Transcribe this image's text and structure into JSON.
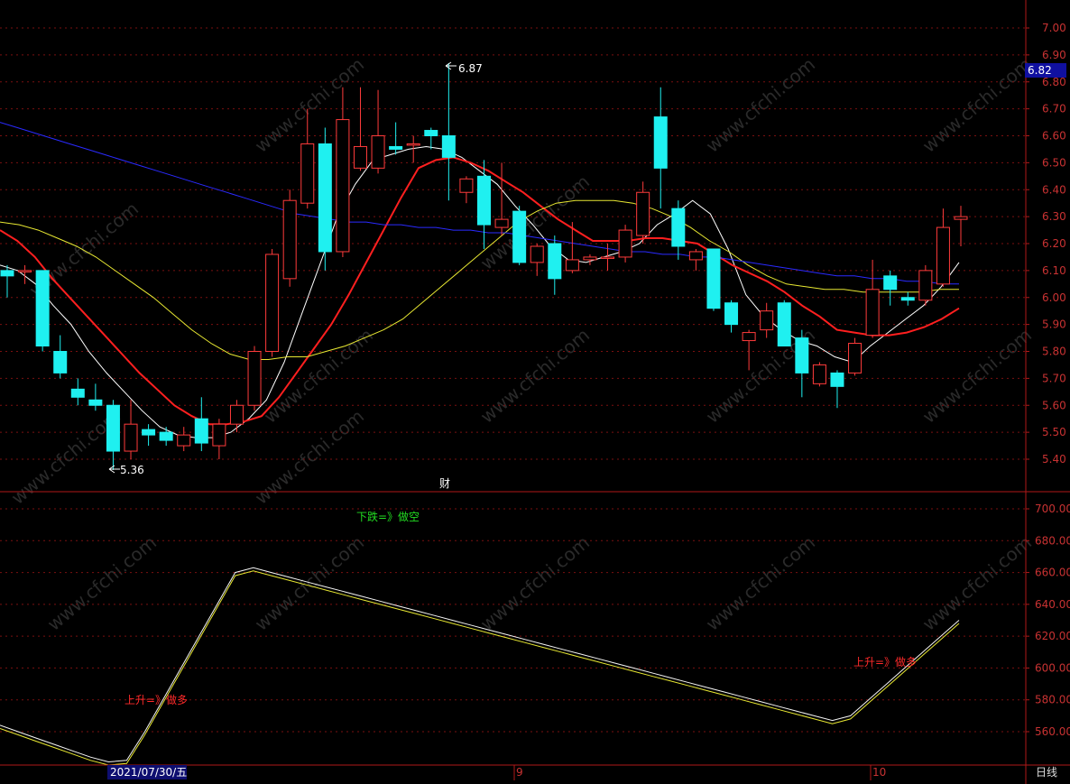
{
  "colors": {
    "up": "#ff3b3b",
    "down": "#1ff0f0",
    "ma5": "#ffffff",
    "ma10": "#ff1f1f",
    "ma20": "#e8e832",
    "ma60": "#2a2aff",
    "grid": "#7a1010",
    "axis_text": "#c83232",
    "price_badge_bg": "#1010a0",
    "price_badge_text": "#ffffff"
  },
  "watermark": "www.cfchi.com",
  "chart_data": [
    {
      "type": "candlestick",
      "yaxis": {
        "ylim": [
          5.33,
          7.07
        ],
        "ticks": [
          "5.40",
          "5.50",
          "5.60",
          "5.70",
          "5.80",
          "5.90",
          "6.00",
          "6.10",
          "6.20",
          "6.30",
          "6.40",
          "6.50",
          "6.60",
          "6.70",
          "6.80",
          "6.90",
          "7.00"
        ]
      },
      "current_price": "6.82",
      "annotations": {
        "high_label": "6.87",
        "low_label": "5.36",
        "marker": "财"
      },
      "candles": [
        {
          "o": 6.1,
          "h": 6.12,
          "l": 6.0,
          "c": 6.08
        },
        {
          "o": 6.1,
          "h": 6.12,
          "l": 6.05,
          "c": 6.1
        },
        {
          "o": 6.1,
          "h": 6.1,
          "l": 5.8,
          "c": 5.82
        },
        {
          "o": 5.8,
          "h": 5.86,
          "l": 5.7,
          "c": 5.72
        },
        {
          "o": 5.66,
          "h": 5.7,
          "l": 5.6,
          "c": 5.63
        },
        {
          "o": 5.62,
          "h": 5.68,
          "l": 5.58,
          "c": 5.6
        },
        {
          "o": 5.6,
          "h": 5.62,
          "l": 5.36,
          "c": 5.43
        },
        {
          "o": 5.43,
          "h": 5.62,
          "l": 5.4,
          "c": 5.53
        },
        {
          "o": 5.51,
          "h": 5.53,
          "l": 5.45,
          "c": 5.49
        },
        {
          "o": 5.5,
          "h": 5.52,
          "l": 5.45,
          "c": 5.47
        },
        {
          "o": 5.45,
          "h": 5.52,
          "l": 5.43,
          "c": 5.49
        },
        {
          "o": 5.55,
          "h": 5.63,
          "l": 5.43,
          "c": 5.46
        },
        {
          "o": 5.45,
          "h": 5.55,
          "l": 5.4,
          "c": 5.53
        },
        {
          "o": 5.53,
          "h": 5.62,
          "l": 5.5,
          "c": 5.6
        },
        {
          "o": 5.6,
          "h": 5.82,
          "l": 5.58,
          "c": 5.8
        },
        {
          "o": 5.8,
          "h": 6.18,
          "l": 5.78,
          "c": 6.16
        },
        {
          "o": 6.07,
          "h": 6.4,
          "l": 6.04,
          "c": 6.36
        },
        {
          "o": 6.35,
          "h": 6.7,
          "l": 6.33,
          "c": 6.57
        },
        {
          "o": 6.57,
          "h": 6.63,
          "l": 6.1,
          "c": 6.17
        },
        {
          "o": 6.17,
          "h": 6.78,
          "l": 6.15,
          "c": 6.66
        },
        {
          "o": 6.48,
          "h": 6.78,
          "l": 6.47,
          "c": 6.56
        },
        {
          "o": 6.48,
          "h": 6.77,
          "l": 6.46,
          "c": 6.6
        },
        {
          "o": 6.56,
          "h": 6.65,
          "l": 6.53,
          "c": 6.55
        },
        {
          "o": 6.57,
          "h": 6.6,
          "l": 6.5,
          "c": 6.57
        },
        {
          "o": 6.62,
          "h": 6.63,
          "l": 6.55,
          "c": 6.6
        },
        {
          "o": 6.6,
          "h": 6.87,
          "l": 6.36,
          "c": 6.52
        },
        {
          "o": 6.39,
          "h": 6.45,
          "l": 6.35,
          "c": 6.44
        },
        {
          "o": 6.45,
          "h": 6.51,
          "l": 6.18,
          "c": 6.27
        },
        {
          "o": 6.26,
          "h": 6.5,
          "l": 6.23,
          "c": 6.29
        },
        {
          "o": 6.32,
          "h": 6.34,
          "l": 6.12,
          "c": 6.13
        },
        {
          "o": 6.13,
          "h": 6.2,
          "l": 6.08,
          "c": 6.19
        },
        {
          "o": 6.2,
          "h": 6.23,
          "l": 6.01,
          "c": 6.07
        },
        {
          "o": 6.1,
          "h": 6.28,
          "l": 6.09,
          "c": 6.14
        },
        {
          "o": 6.14,
          "h": 6.16,
          "l": 6.12,
          "c": 6.15
        },
        {
          "o": 6.15,
          "h": 6.2,
          "l": 6.1,
          "c": 6.15
        },
        {
          "o": 6.15,
          "h": 6.27,
          "l": 6.13,
          "c": 6.25
        },
        {
          "o": 6.23,
          "h": 6.43,
          "l": 6.2,
          "c": 6.39
        },
        {
          "o": 6.67,
          "h": 6.78,
          "l": 6.33,
          "c": 6.48
        },
        {
          "o": 6.33,
          "h": 6.36,
          "l": 6.14,
          "c": 6.19
        },
        {
          "o": 6.14,
          "h": 6.18,
          "l": 6.1,
          "c": 6.17
        },
        {
          "o": 6.18,
          "h": 6.18,
          "l": 5.95,
          "c": 5.96
        },
        {
          "o": 5.98,
          "h": 5.99,
          "l": 5.87,
          "c": 5.9
        },
        {
          "o": 5.84,
          "h": 5.88,
          "l": 5.73,
          "c": 5.87
        },
        {
          "o": 5.88,
          "h": 5.98,
          "l": 5.85,
          "c": 5.95
        },
        {
          "o": 5.98,
          "h": 5.99,
          "l": 5.83,
          "c": 5.82
        },
        {
          "o": 5.85,
          "h": 5.88,
          "l": 5.63,
          "c": 5.72
        },
        {
          "o": 5.68,
          "h": 5.76,
          "l": 5.67,
          "c": 5.75
        },
        {
          "o": 5.72,
          "h": 5.73,
          "l": 5.59,
          "c": 5.67
        },
        {
          "o": 5.72,
          "h": 5.85,
          "l": 5.71,
          "c": 5.83
        },
        {
          "o": 5.86,
          "h": 6.14,
          "l": 5.85,
          "c": 6.03
        },
        {
          "o": 6.08,
          "h": 6.1,
          "l": 5.97,
          "c": 6.03
        },
        {
          "o": 6.0,
          "h": 6.02,
          "l": 5.97,
          "c": 5.99
        },
        {
          "o": 5.99,
          "h": 6.12,
          "l": 5.97,
          "c": 6.1
        },
        {
          "o": 6.05,
          "h": 6.33,
          "l": 6.04,
          "c": 6.26
        },
        {
          "o": 6.29,
          "h": 6.34,
          "l": 6.19,
          "c": 6.3
        }
      ],
      "moving_averages": [
        {
          "name": "MA5",
          "values": [
            6.12,
            6.1,
            6.05,
            5.97,
            5.9,
            5.8,
            5.72,
            5.65,
            5.58,
            5.52,
            5.49,
            5.48,
            5.48,
            5.5,
            5.55,
            5.62,
            5.76,
            5.94,
            6.12,
            6.3,
            6.42,
            6.51,
            6.53,
            6.55,
            6.56,
            6.55,
            6.52,
            6.47,
            6.42,
            6.34,
            6.27,
            6.19,
            6.14,
            6.13,
            6.15,
            6.17,
            6.2,
            6.27,
            6.31,
            6.36,
            6.31,
            6.18,
            6.01,
            5.93,
            5.88,
            5.84,
            5.82,
            5.78,
            5.76,
            5.82,
            5.87,
            5.92,
            5.97,
            6.04,
            6.13
          ]
        },
        {
          "name": "MA10",
          "values": [
            6.25,
            6.21,
            6.15,
            6.07,
            6.0,
            5.93,
            5.86,
            5.79,
            5.72,
            5.66,
            5.6,
            5.56,
            5.53,
            5.53,
            5.54,
            5.56,
            5.63,
            5.72,
            5.81,
            5.9,
            6.01,
            6.13,
            6.25,
            6.37,
            6.48,
            6.51,
            6.52,
            6.5,
            6.47,
            6.43,
            6.39,
            6.34,
            6.29,
            6.25,
            6.21,
            6.21,
            6.21,
            6.22,
            6.22,
            6.21,
            6.2,
            6.16,
            6.12,
            6.09,
            6.06,
            6.02,
            5.97,
            5.93,
            5.88,
            5.87,
            5.86,
            5.86,
            5.87,
            5.89,
            5.92,
            5.96
          ]
        },
        {
          "name": "MA20",
          "values": [
            6.28,
            6.27,
            6.25,
            6.22,
            6.19,
            6.15,
            6.1,
            6.05,
            6.0,
            5.94,
            5.88,
            5.83,
            5.79,
            5.77,
            5.77,
            5.78,
            5.78,
            5.8,
            5.82,
            5.85,
            5.88,
            5.92,
            5.98,
            6.04,
            6.1,
            6.16,
            6.22,
            6.28,
            6.32,
            6.35,
            6.36,
            6.36,
            6.36,
            6.35,
            6.33,
            6.3,
            6.26,
            6.21,
            6.17,
            6.12,
            6.08,
            6.05,
            6.04,
            6.03,
            6.03,
            6.02,
            6.02,
            6.02,
            6.02,
            6.03,
            6.03
          ]
        },
        {
          "name": "MA60",
          "values": [
            6.65,
            6.63,
            6.61,
            6.59,
            6.57,
            6.55,
            6.53,
            6.51,
            6.49,
            6.47,
            6.45,
            6.43,
            6.41,
            6.39,
            6.37,
            6.35,
            6.33,
            6.31,
            6.3,
            6.29,
            6.28,
            6.28,
            6.27,
            6.27,
            6.26,
            6.26,
            6.25,
            6.25,
            6.24,
            6.24,
            6.23,
            6.22,
            6.21,
            6.2,
            6.19,
            6.18,
            6.17,
            6.17,
            6.16,
            6.16,
            6.15,
            6.15,
            6.14,
            6.13,
            6.12,
            6.11,
            6.1,
            6.09,
            6.08,
            6.08,
            6.07,
            6.07,
            6.06,
            6.06,
            6.05,
            6.05
          ]
        }
      ]
    },
    {
      "type": "line",
      "yaxis": {
        "ylim": [
          545,
          707
        ],
        "ticks": [
          "560.00",
          "580.00",
          "600.00",
          "620.00",
          "640.00",
          "660.00",
          "680.00",
          "700.00"
        ]
      },
      "series": [
        {
          "values": [
            564,
            560,
            556,
            552,
            548,
            544,
            541,
            542,
            560,
            580,
            600,
            620,
            640,
            660,
            663,
            660,
            657,
            654,
            651,
            648,
            645,
            642,
            639,
            636,
            633,
            630,
            627,
            624,
            621,
            618,
            615,
            612,
            609,
            606,
            603,
            600,
            597,
            594,
            591,
            588,
            585,
            582,
            579,
            576,
            573,
            570,
            567,
            570,
            580,
            590,
            600,
            610,
            620,
            630
          ]
        },
        {
          "values": [
            562,
            558,
            554,
            550,
            546,
            542,
            539,
            540,
            558,
            578,
            598,
            618,
            638,
            658,
            661,
            658,
            655,
            652,
            649,
            646,
            643,
            640,
            637,
            634,
            631,
            628,
            625,
            622,
            619,
            616,
            613,
            610,
            607,
            604,
            601,
            598,
            595,
            592,
            589,
            586,
            583,
            580,
            577,
            574,
            571,
            568,
            565,
            568,
            578,
            588,
            598,
            608,
            618,
            628
          ]
        }
      ],
      "annotations": [
        {
          "text": "上升=》做多",
          "color": "#ff2a2a"
        },
        {
          "text": "下跌=》做空",
          "color": "#22dd22"
        },
        {
          "text": "上升=》做多",
          "color": "#ff2a2a"
        }
      ]
    }
  ],
  "xaxis": {
    "labels": [
      "2021/07/30/五",
      "9",
      "10"
    ],
    "period": "日线"
  }
}
